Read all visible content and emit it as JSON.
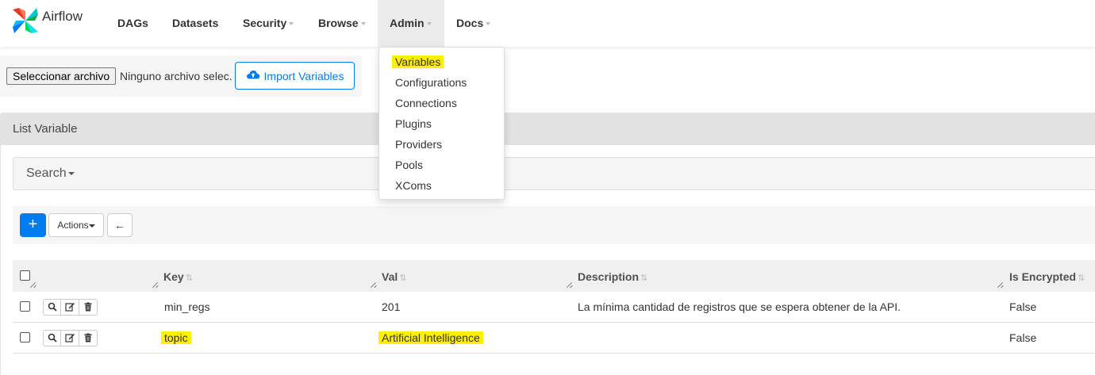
{
  "brand": {
    "name": "Airflow",
    "logo_icon": "airflow-pinwheel-icon"
  },
  "nav": {
    "items": [
      {
        "label": "DAGs",
        "dropdown": false
      },
      {
        "label": "Datasets",
        "dropdown": false
      },
      {
        "label": "Security",
        "dropdown": true
      },
      {
        "label": "Browse",
        "dropdown": true
      },
      {
        "label": "Admin",
        "dropdown": true,
        "open": true
      },
      {
        "label": "Docs",
        "dropdown": true
      }
    ]
  },
  "admin_menu": {
    "items": [
      "Variables",
      "Configurations",
      "Connections",
      "Plugins",
      "Providers",
      "Pools",
      "XComs"
    ],
    "highlighted": "Variables",
    "highlight_color": "#ffef00"
  },
  "import": {
    "file_button": "Seleccionar archivo",
    "file_status": "Ninguno archivo selec.",
    "import_button": "Import Variables",
    "import_icon": "cloud-upload-icon"
  },
  "panel": {
    "title": "List Variable"
  },
  "search": {
    "label": "Search"
  },
  "toolbar": {
    "add_label": "+",
    "actions_label": "Actions",
    "back_icon": "arrow-left-icon"
  },
  "table": {
    "columns": [
      "Key",
      "Val",
      "Description",
      "Is Encrypted"
    ],
    "rows": [
      {
        "key": "min_regs",
        "val": "201",
        "description": "La mínima cantidad de registros que se espera obtener de la API.",
        "is_encrypted": "False"
      },
      {
        "key": "topic",
        "val": "Artificial Intelligence",
        "description": "",
        "is_encrypted": "False"
      }
    ]
  },
  "colors": {
    "accent": "#017cee",
    "highlight": "#ffef00"
  }
}
